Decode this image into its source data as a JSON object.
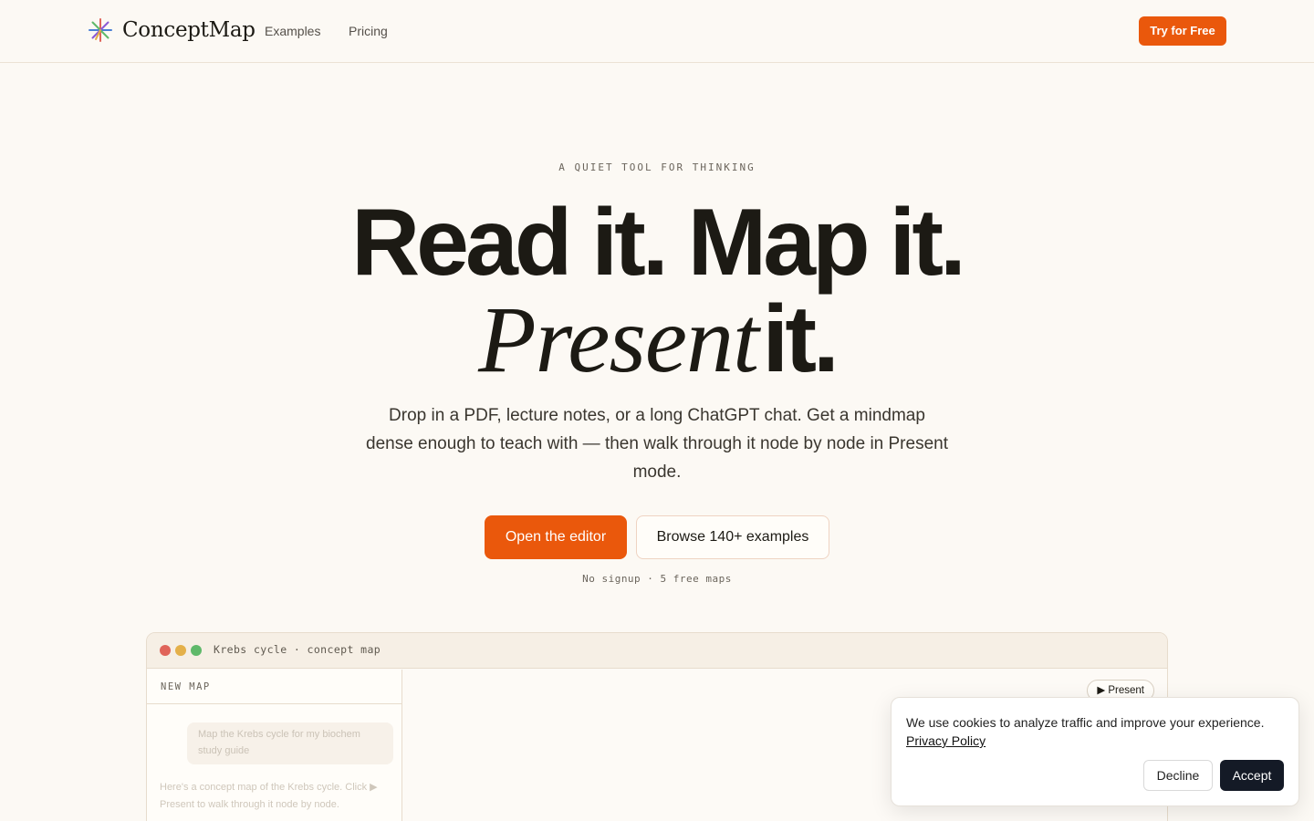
{
  "nav": {
    "brand": "ConceptMap",
    "links": [
      "Examples",
      "Pricing"
    ],
    "cta": "Try for Free"
  },
  "hero": {
    "eyebrow": "A QUIET TOOL FOR THINKING",
    "headline_line1": "Read it. Map it.",
    "headline_italic": "Present",
    "headline_end": "it.",
    "subhead": "Drop in a PDF, lecture notes, or a long ChatGPT chat. Get a mindmap dense enough to teach with — then walk through it node by node in Present mode.",
    "primary_cta": "Open the editor",
    "secondary_cta": "Browse 140+ examples",
    "note": "No signup · 5 free maps"
  },
  "preview": {
    "window_title": "Krebs cycle · concept map",
    "panel_header": "NEW MAP",
    "present_label": "▶ Present",
    "chat_bubble": "Map the Krebs cycle for my biochem study guide",
    "chat_reply": "Here's a concept map of the Krebs cycle. Click ▶ Present to walk through it node by node."
  },
  "cookie": {
    "message": "We use cookies to analyze traffic and improve your experience.",
    "link": "Privacy Policy",
    "decline": "Decline",
    "accept": "Accept"
  },
  "colors": {
    "accent": "#ea580c",
    "background": "#fcf9f4",
    "ink": "#1c1a14",
    "accept_button": "#141a26"
  }
}
